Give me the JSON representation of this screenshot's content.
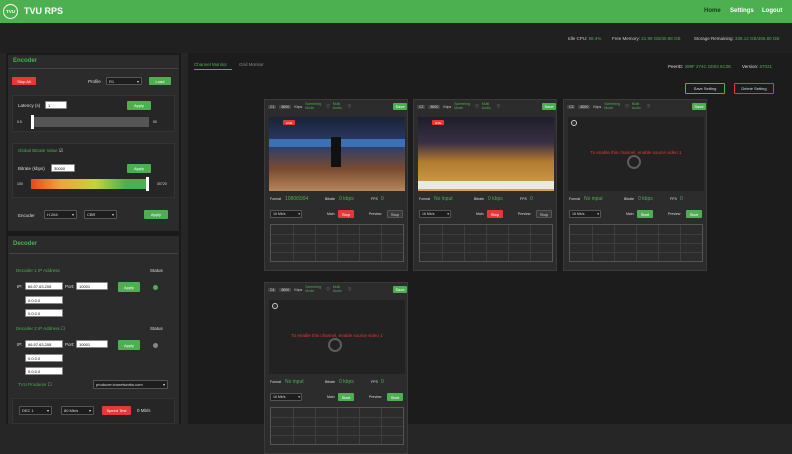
{
  "app": {
    "logo": "TVU",
    "title": "TVU RPS"
  },
  "nav": {
    "home": "Home",
    "settings": "Settings",
    "logout": "Logout"
  },
  "status": {
    "cpu_label": "Idle CPU:",
    "cpu_value": "98.4%",
    "mem_label": "Free Memory:",
    "mem_value": "21.99 GB/30.88 GB",
    "storage_label": "Storage Remaining:",
    "storage_value": "338.12 GB/465.80 GB"
  },
  "encoder": {
    "title": "Encoder",
    "stop_all": "Stop All",
    "profile_label": "Profile",
    "profile_value": "R1",
    "load": "Load",
    "latency_label": "Latency (s)",
    "latency_value": "1",
    "apply": "Apply",
    "latency_min": "0.5",
    "latency_max": "50",
    "latency_fraction": 0.0,
    "global_bitrate_label": "Global Bitrate Value",
    "bitrate_label": "Bitrate (kbps)",
    "bitrate_value": "30000",
    "bitrate_min": "100",
    "bitrate_max": "30720",
    "bitrate_fraction": 0.976,
    "encoder_label": "Encoder",
    "codec_value": "H.264",
    "mode_value": "CBR"
  },
  "decoder": {
    "title": "Decoder",
    "d1_label": "Decoder 1 IP Address",
    "d2_label": "Decoder 2 IP Address",
    "status_label": "Status",
    "ip_label": "IP:",
    "port_label": "Port:",
    "d1_ip": "66.57.63.208",
    "d1_port": "10001",
    "d2_ip": "66.57.63.208",
    "d2_port": "10001",
    "empty_ip": "0.0.0.0",
    "apply": "Apply",
    "producer_label": "TVU Producer",
    "producer_value": "producer.tvunetworks.com",
    "dec_value": "DEC 1",
    "speed_value": "80 Mb/s",
    "speed_test": "Speed Test",
    "speed_result": "0 Mb/s"
  },
  "main": {
    "tab_channel": "Channel Monitor",
    "tab_grid": "Grid Monitor",
    "peer_label": "PeerID:",
    "peer_value": "399F 274C 0D03 6C0E",
    "version_label": "Version:",
    "version_value": "67021",
    "save_setting": "Save Setting",
    "delete_setting": "Delete Setting"
  },
  "channel_common": {
    "bitrate_badge": "8000",
    "kbps": "Kbps",
    "screening_mode": "Screening Mode",
    "audio": "Multi Audio",
    "save": "Save",
    "format_label": "Format",
    "bitrate_label": "Bitrate",
    "fps_label": "FPS",
    "main_label": "Main",
    "preview_label": "Preview",
    "warning": "To enable this channel, enable source video 1",
    "live": "LIVE"
  },
  "channels": [
    {
      "id": "C1",
      "format": "1080i5994",
      "bitrate": "0 kbps",
      "fps": "0",
      "speed": "16 Mb/s",
      "main_btn": "Stop",
      "preview_btn": "Stop"
    },
    {
      "id": "C2",
      "format": "No input",
      "bitrate": "0 kbps",
      "fps": "0",
      "speed": "16 Mb/s",
      "main_btn": "Stop",
      "preview_btn": "Stop"
    },
    {
      "id": "C3",
      "format": "No input",
      "bitrate": "0 kbps",
      "fps": "0",
      "speed": "16 Mb/s",
      "main_btn": "Start",
      "preview_btn": "Start"
    },
    {
      "id": "C4",
      "format": "No input",
      "bitrate": "0 kbps",
      "fps": "0",
      "speed": "16 Mb/s",
      "main_btn": "Start",
      "preview_btn": "Start"
    }
  ],
  "colors": {
    "accent": "#4caf50",
    "danger": "#e53935"
  }
}
